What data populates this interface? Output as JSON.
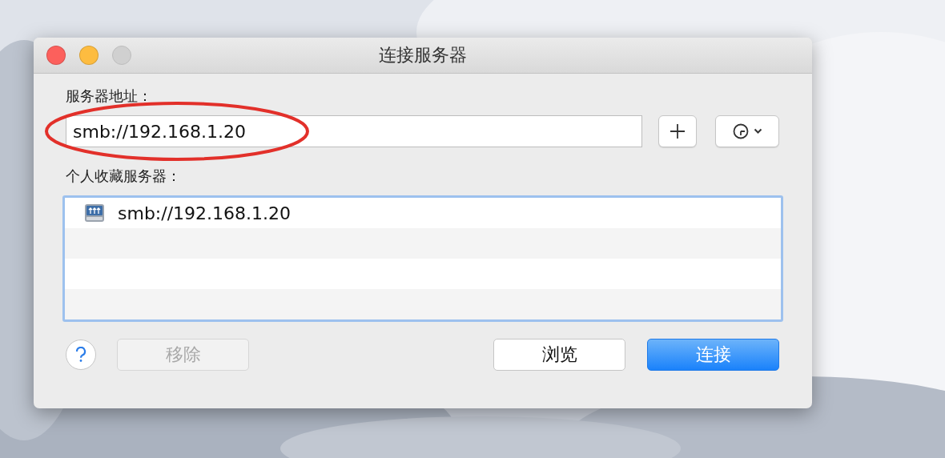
{
  "window": {
    "title": "连接服务器",
    "controls": [
      {
        "kind": "close",
        "disabled": false
      },
      {
        "kind": "minimize",
        "disabled": false
      },
      {
        "kind": "zoom",
        "disabled": true
      }
    ]
  },
  "server_address": {
    "label": "服务器地址：",
    "value": "smb://192.168.1.20",
    "highlighted": true
  },
  "favorites": {
    "label": "个人收藏服务器：",
    "items": [
      {
        "address": "smb://192.168.1.20"
      }
    ]
  },
  "buttons": [
    {
      "kind": "remove",
      "label": "移除",
      "disabled": true,
      "default": false
    },
    {
      "kind": "browse",
      "label": "浏览",
      "disabled": false,
      "default": false
    },
    {
      "kind": "connect",
      "label": "连接",
      "disabled": false,
      "default": true
    }
  ]
}
